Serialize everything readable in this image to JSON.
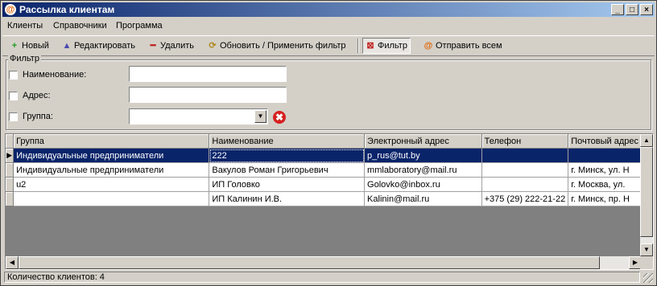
{
  "window": {
    "title": "Рассылка клиентам",
    "app_icon": "@",
    "buttons": [
      "_",
      "□",
      "×"
    ]
  },
  "menu": [
    "Клиенты",
    "Справочники",
    "Программа"
  ],
  "toolbar": {
    "new": "Новый",
    "edit": "Редактировать",
    "delete": "Удалить",
    "refresh": "Обновить / Применить фильтр",
    "filter": "Фильтр",
    "send_all": "Отправить всем"
  },
  "filter": {
    "legend": "Фильтр",
    "name_label": "Наименование:",
    "name_value": "",
    "address_label": "Адрес:",
    "address_value": "",
    "group_label": "Группа:",
    "group_value": ""
  },
  "grid": {
    "columns": [
      "Группа",
      "Наименование",
      "Электронный адрес",
      "Телефон",
      "Почтовый адрес"
    ],
    "rows": [
      [
        "Индивидуальные предприниматели",
        "222",
        "p_rus@tut.by",
        "",
        ""
      ],
      [
        "Индивидуальные предприниматели",
        "Вакулов Роман Григорьевич",
        "mmlaboratory@mail.ru",
        "",
        "г. Минск, ул. Н"
      ],
      [
        "u2",
        "ИП Головко",
        "Golovko@inbox.ru",
        "",
        "г. Москва, ул."
      ],
      [
        "",
        "ИП Калинин И.В.",
        "Kalinin@mail.ru",
        "+375 (29) 222-21-22",
        "г. Минск, пр. Н"
      ]
    ],
    "selected_row": 0
  },
  "status": {
    "text": "Количество клиентов: 4"
  },
  "colors": {
    "selection": "#0a246a",
    "title_start": "#0a246a",
    "title_end": "#a6caf0",
    "face": "#d4d0c8"
  }
}
